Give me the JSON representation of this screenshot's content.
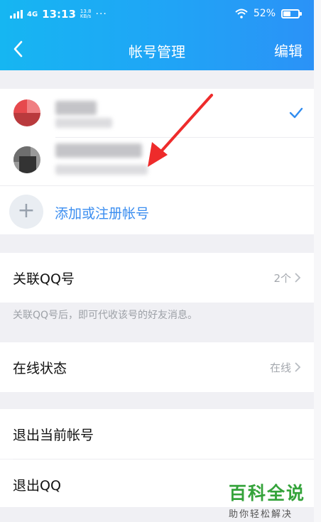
{
  "status_bar": {
    "network": "4G",
    "time": "13:13",
    "speed": "13.8",
    "speed_unit": "KB/s",
    "dots": "···",
    "battery": "52%",
    "battery_level": 0.52
  },
  "header": {
    "title": "帐号管理",
    "edit_label": "编辑",
    "back_icon": "chevron-left-icon"
  },
  "accounts": {
    "items": [
      {
        "selected": true,
        "avatar_colors": [
          "#e6494d",
          "#f07f82",
          "#b93a3d"
        ]
      },
      {
        "selected": false,
        "avatar_colors": [
          "#333333",
          "#6e6e6e",
          "#9a9a9a"
        ]
      }
    ],
    "add_label": "添加或注册帐号",
    "check_color": "#2f8cf0"
  },
  "linked_qq": {
    "label": "关联QQ号",
    "value": "2个"
  },
  "hint": "关联QQ号后，即可代收该号的好友消息。",
  "online_status": {
    "label": "在线状态",
    "value": "在线"
  },
  "logout_account": {
    "label": "退出当前帐号"
  },
  "logout_qq": {
    "label": "退出QQ"
  },
  "annotation": {
    "arrow_color": "#ee2b2b"
  },
  "watermark": {
    "main": "百科全说",
    "sub": "助你轻松解决"
  }
}
